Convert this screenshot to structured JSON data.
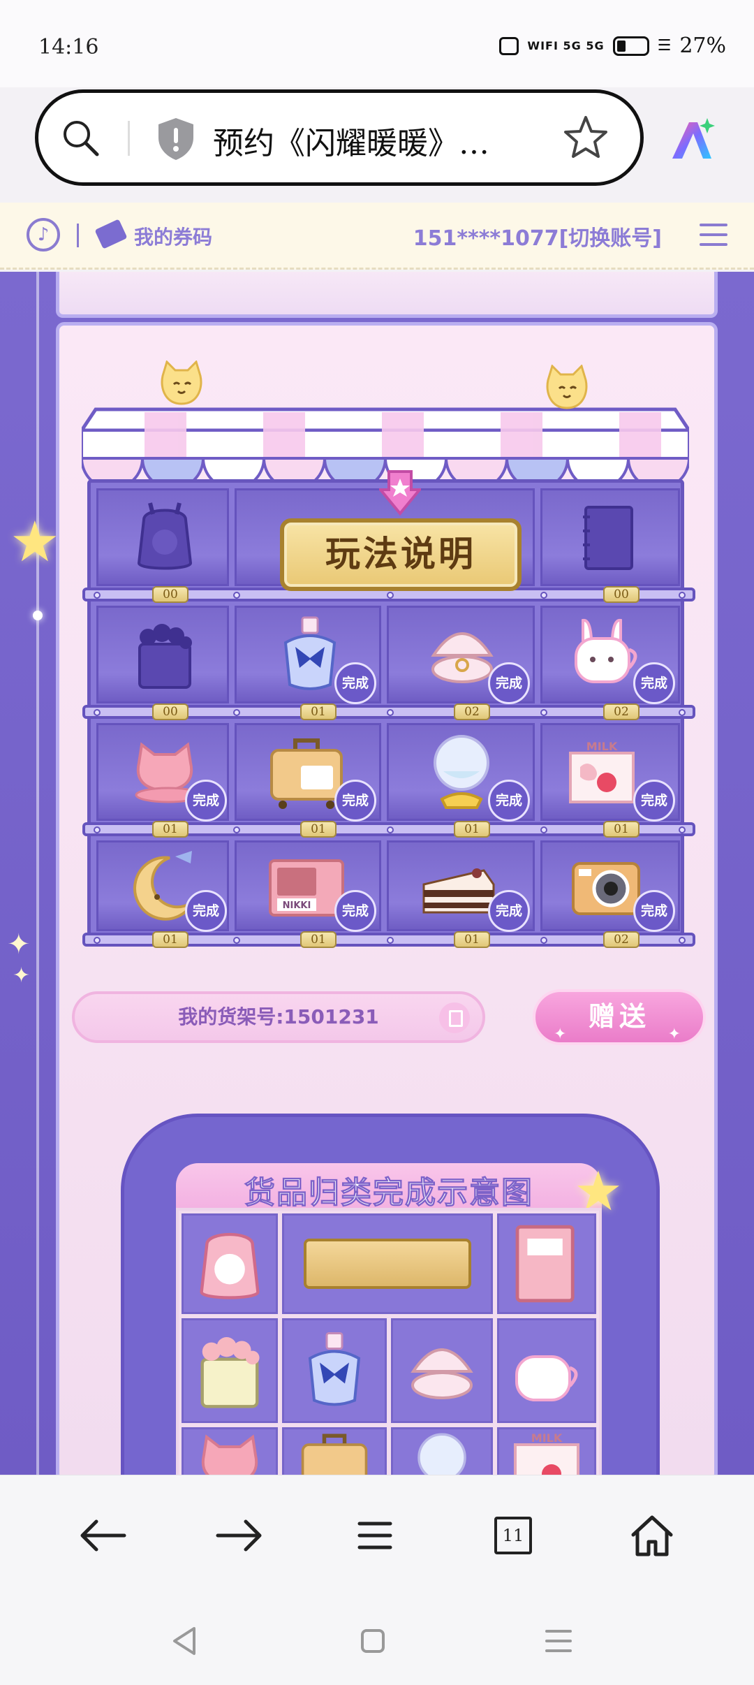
{
  "status_bar": {
    "time": "14:16",
    "network": "WIFI 5G 5G",
    "battery_percent": "27%"
  },
  "address_bar": {
    "title": "预约《闪耀暖暖》…"
  },
  "header": {
    "coupon_label": "我的券码",
    "account": "151****1077[切换账号]"
  },
  "shelf": {
    "rules_button": "玩法说明",
    "rows": [
      [
        {
          "icon": "backpack-icon",
          "count": "00",
          "done": false
        },
        {
          "icon": "rules-board",
          "count": "",
          "done": false
        },
        {
          "icon": "rules-board",
          "count": "",
          "done": false
        },
        {
          "icon": "notebook-icon",
          "count": "00",
          "done": false
        }
      ],
      [
        {
          "icon": "flower-basket-icon",
          "count": "00",
          "done": false
        },
        {
          "icon": "perfume-bottle-icon",
          "count": "01",
          "done": true
        },
        {
          "icon": "shell-ring-box-icon",
          "count": "02",
          "done": true
        },
        {
          "icon": "bunny-mug-icon",
          "count": "02",
          "done": true
        }
      ],
      [
        {
          "icon": "pink-hat-icon",
          "count": "01",
          "done": true
        },
        {
          "icon": "suitcase-icon",
          "count": "01",
          "done": true
        },
        {
          "icon": "crystal-ball-icon",
          "count": "01",
          "done": true
        },
        {
          "icon": "milk-carton-icon",
          "count": "01",
          "done": true
        }
      ],
      [
        {
          "icon": "moon-pillow-icon",
          "count": "01",
          "done": true
        },
        {
          "icon": "eyeshadow-palette-icon",
          "count": "01",
          "done": true
        },
        {
          "icon": "cake-slice-icon",
          "count": "01",
          "done": true
        },
        {
          "icon": "camera-icon",
          "count": "02",
          "done": true
        }
      ]
    ],
    "done_label": "完成"
  },
  "shelf_number": "我的货架号:1501231",
  "send_button": "赠送",
  "diagram": {
    "title": "货品归类完成示意图"
  },
  "bottom_nav": {
    "tab_count": "11"
  },
  "colors": {
    "game_bg": "#7b69cf",
    "panel_pink": "#fbe8f6",
    "accent_lavender": "#8c7cd6",
    "send_pink": "#ea7cc9"
  }
}
